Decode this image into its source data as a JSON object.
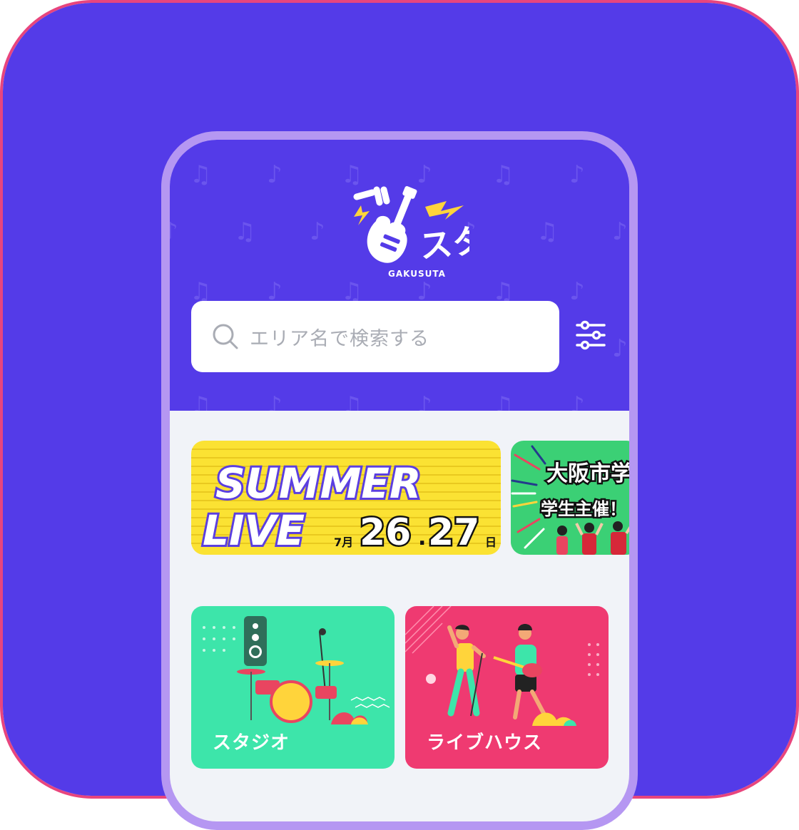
{
  "colors": {
    "app_icon_background": "#543be8",
    "app_icon_border": "#e8457d",
    "phone_frame": "#b597f2",
    "header_background": "#543be8",
    "content_background": "#f1f3f8",
    "studio_card": "#3de5aa",
    "livehouse_card": "#ef3a71",
    "summer_banner": "#fbe233",
    "osaka_banner": "#3bd075"
  },
  "header": {
    "logo": {
      "wordmark": "GAKUSUTA",
      "katakana": "スタ"
    },
    "search": {
      "placeholder": "エリア名で検索する",
      "icon": "search-icon"
    },
    "filter_button": {
      "icon": "sliders-icon"
    }
  },
  "banners": [
    {
      "line1": "SUMMER",
      "line2": "LIVE",
      "month": "7月",
      "day1": "26",
      "separator": ".",
      "day2": "27",
      "day_suffix": "日"
    },
    {
      "line1": "大阪市学",
      "line2": "学生主催！"
    }
  ],
  "categories": [
    {
      "label": "スタジオ",
      "icon": "drum-kit-illustration"
    },
    {
      "label": "ライブハウス",
      "icon": "band-performers-illustration"
    }
  ]
}
